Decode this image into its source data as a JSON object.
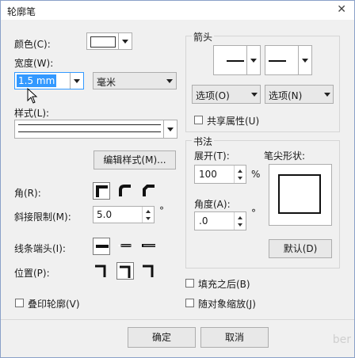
{
  "window": {
    "title": "轮廓笔",
    "close_glyph": "✕"
  },
  "left": {
    "color_label": "颜色(C):",
    "width_label": "宽度(W):",
    "width_value": "1.5 mm",
    "unit_value": "毫米",
    "style_label": "样式(L):",
    "edit_style_button": "编辑样式(M)...",
    "corner_label": "角(R):",
    "miter_label": "斜接限制(M):",
    "miter_value": "5.0",
    "miter_unit": "°",
    "cap_label": "线条端头(I):",
    "position_label": "位置(P):",
    "overprint_label": "叠印轮廓(V)"
  },
  "arrows": {
    "group_label": "箭头",
    "options_left": "选项(O)",
    "options_right": "选项(N)",
    "share_label": "共享属性(U)"
  },
  "calligraphy": {
    "group_label": "书法",
    "stretch_label": "展开(T):",
    "stretch_value": "100",
    "stretch_unit": "%",
    "nib_label": "笔尖形状:",
    "angle_label": "角度(A):",
    "angle_value": ".0",
    "angle_unit": "°",
    "default_button": "默认(D)"
  },
  "options": {
    "fill_behind_label": "填充之后(B)",
    "scale_with_object_label": "随对象缩放(J)"
  },
  "footer": {
    "ok_button": "确定",
    "cancel_button": "取消"
  },
  "watermark": "ber",
  "colors": {
    "selection": "#3399ff",
    "border": "#adadad",
    "dialog_bg": "#f0f0f0"
  },
  "state": {
    "corner_selected_index": 0,
    "cap_selected_index": 0,
    "position_selected_index": 1,
    "overprint_checked": false,
    "share_checked": false,
    "fill_behind_checked": false,
    "scale_with_object_checked": false
  }
}
